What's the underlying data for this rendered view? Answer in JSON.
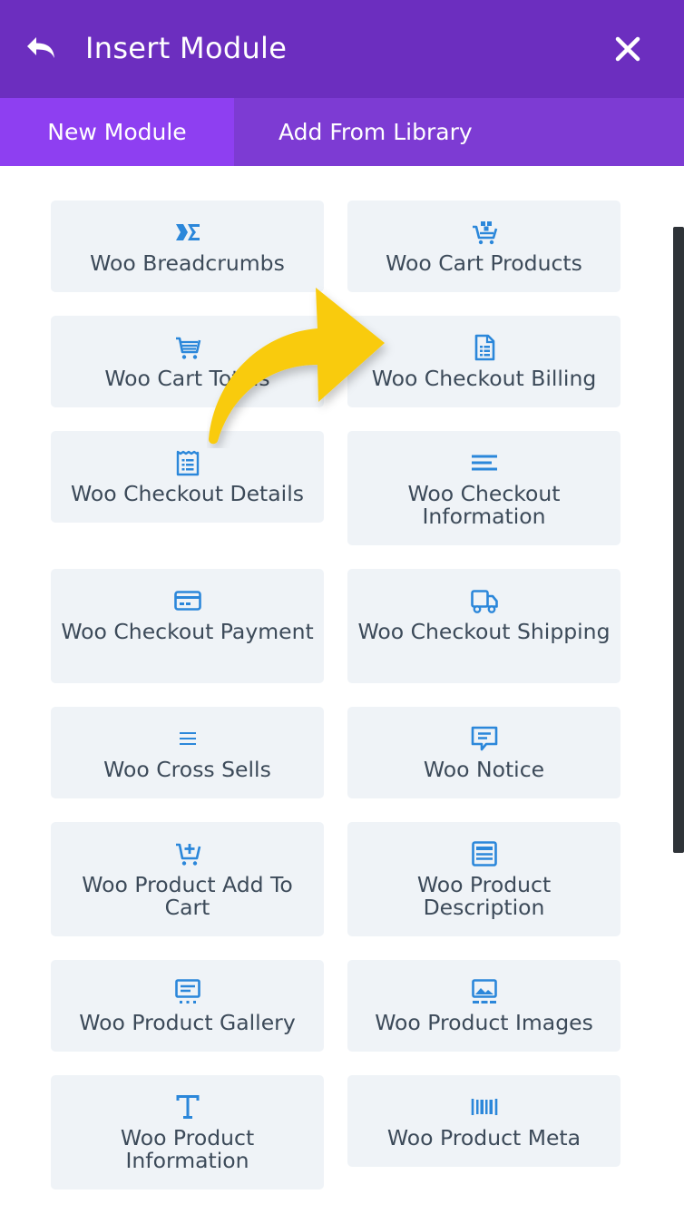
{
  "header": {
    "title": "Insert Module",
    "back_icon": "back-arrow-icon",
    "close_icon": "close-icon"
  },
  "tabs": [
    {
      "label": "New Module",
      "active": true
    },
    {
      "label": "Add From Library",
      "active": false
    }
  ],
  "colors": {
    "header": "#6c2ebf",
    "tab_bar": "#7d3bd3",
    "active_tab": "#8e3ff1",
    "card": "#eff3f7",
    "icon": "#2b87da",
    "text": "#3c4a59",
    "arrow": "#f9cb0c"
  },
  "modules": [
    {
      "label": "Woo Breadcrumbs",
      "icon": "breadcrumbs-icon"
    },
    {
      "label": "Woo Cart Products",
      "icon": "cart-products-icon"
    },
    {
      "label": "Woo Cart Totals",
      "icon": "cart-totals-icon"
    },
    {
      "label": "Woo Checkout Billing",
      "icon": "billing-document-icon"
    },
    {
      "label": "Woo Checkout Details",
      "icon": "checkout-details-icon"
    },
    {
      "label": "Woo Checkout Information",
      "icon": "text-lines-icon"
    },
    {
      "label": "Woo Checkout Payment",
      "icon": "credit-card-icon"
    },
    {
      "label": "Woo Checkout Shipping",
      "icon": "truck-icon"
    },
    {
      "label": "Woo Cross Sells",
      "icon": "list-lines-icon"
    },
    {
      "label": "Woo Notice",
      "icon": "notice-bubble-icon"
    },
    {
      "label": "Woo Product Add To Cart",
      "icon": "add-to-cart-icon"
    },
    {
      "label": "Woo Product Description",
      "icon": "description-icon"
    },
    {
      "label": "Woo Product Gallery",
      "icon": "gallery-icon"
    },
    {
      "label": "Woo Product Images",
      "icon": "images-icon"
    },
    {
      "label": "Woo Product Information",
      "icon": "text-t-icon"
    },
    {
      "label": "Woo Product Meta",
      "icon": "barcode-icon"
    }
  ]
}
